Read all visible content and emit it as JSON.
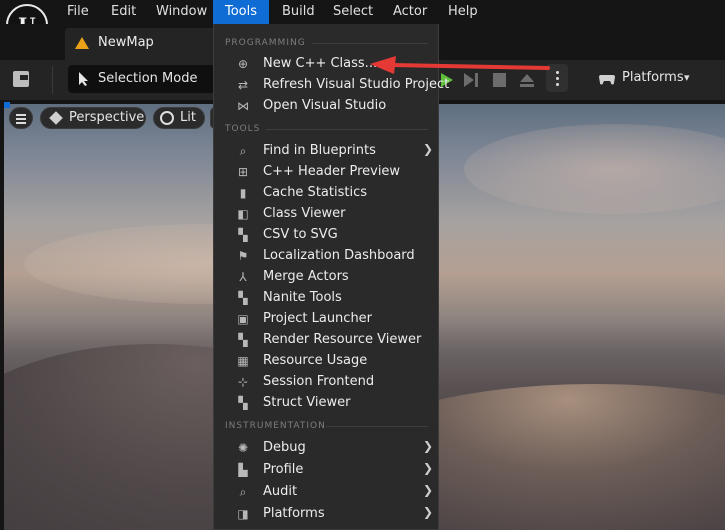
{
  "menubar": {
    "logo": "U",
    "items": [
      "File",
      "Edit",
      "Window",
      "Tools",
      "Build",
      "Select",
      "Actor",
      "Help"
    ],
    "active": "Tools"
  },
  "tab": {
    "label": "NewMap"
  },
  "toolbar": {
    "mode_label": "Selection Mode",
    "platforms_label": "Platforms"
  },
  "viewport": {
    "perspective_label": "Perspective",
    "lit_label": "Lit"
  },
  "tools_menu": {
    "sections": [
      {
        "header": "PROGRAMMING",
        "items": [
          {
            "label": "New C++ Class...",
            "icon": "class-icon"
          },
          {
            "label": "Refresh Visual Studio Project",
            "icon": "refresh-icon"
          },
          {
            "label": "Open Visual Studio",
            "icon": "visual-studio-icon"
          }
        ]
      },
      {
        "header": "TOOLS",
        "items": [
          {
            "label": "Find in Blueprints",
            "icon": "search-icon",
            "submenu": true
          },
          {
            "label": "C++ Header Preview",
            "icon": "header-preview-icon"
          },
          {
            "label": "Cache Statistics",
            "icon": "bar-chart-icon"
          },
          {
            "label": "Class Viewer",
            "icon": "class-viewer-icon"
          },
          {
            "label": "CSV to SVG",
            "icon": "csv-icon"
          },
          {
            "label": "Localization Dashboard",
            "icon": "flag-icon"
          },
          {
            "label": "Merge Actors",
            "icon": "merge-icon"
          },
          {
            "label": "Nanite Tools",
            "icon": "nanite-icon"
          },
          {
            "label": "Project Launcher",
            "icon": "launcher-icon"
          },
          {
            "label": "Render Resource Viewer",
            "icon": "render-resource-icon"
          },
          {
            "label": "Resource Usage",
            "icon": "table-icon"
          },
          {
            "label": "Session Frontend",
            "icon": "session-icon"
          },
          {
            "label": "Struct Viewer",
            "icon": "struct-icon"
          }
        ]
      },
      {
        "header": "INSTRUMENTATION",
        "items": [
          {
            "label": "Debug",
            "icon": "bug-icon",
            "submenu": true
          },
          {
            "label": "Profile",
            "icon": "profile-icon",
            "submenu": true
          },
          {
            "label": "Audit",
            "icon": "audit-icon",
            "submenu": true
          },
          {
            "label": "Platforms",
            "icon": "platforms-icon",
            "submenu": true
          }
        ]
      }
    ]
  },
  "colors": {
    "accent": "#0e6cd4",
    "annotation_arrow": "#e53935",
    "play_green": "#5fbf3a",
    "map_tab_icon": "#e8a118"
  }
}
